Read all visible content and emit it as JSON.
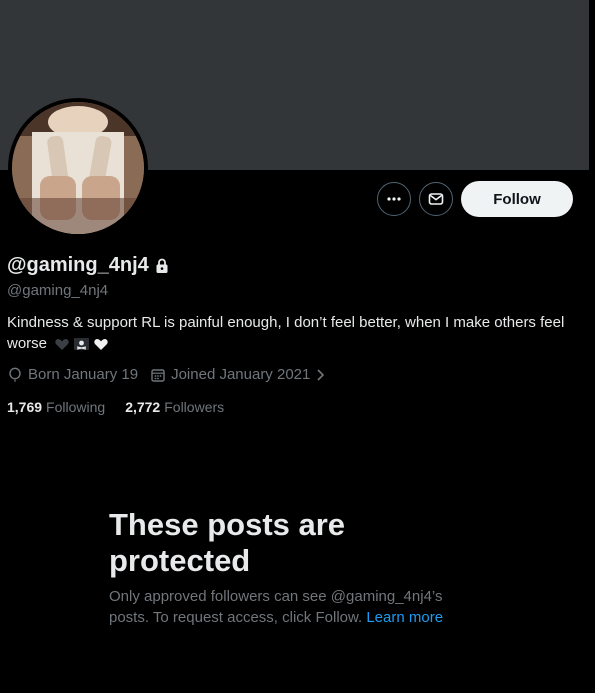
{
  "profile": {
    "display_name": "@gaming_4nj4",
    "handle": "@gaming_4nj4",
    "bio": "Kindness & support RL is painful enough, I don’t feel better, when I make others feel worse",
    "bio_emojis": [
      "black-heart-icon",
      "pirate-flag-icon",
      "white-heart-icon"
    ],
    "born": "Born January 19",
    "joined": "Joined January 2021",
    "following_count": "1,769",
    "following_label": "Following",
    "followers_count": "2,772",
    "followers_label": "Followers"
  },
  "actions": {
    "more_icon": "more-icon",
    "message_icon": "mail-icon",
    "follow_label": "Follow"
  },
  "protected": {
    "title": "These posts are protected",
    "body": "Only approved followers can see @gaming_4nj4’s posts. To request access, click Follow.",
    "link_text": "Learn more"
  },
  "colors": {
    "background": "#000000",
    "banner": "#333639",
    "text_primary": "#e7e9ea",
    "text_secondary": "#71767b",
    "link": "#1d9bf0",
    "follow_button_bg": "#eff3f4"
  }
}
